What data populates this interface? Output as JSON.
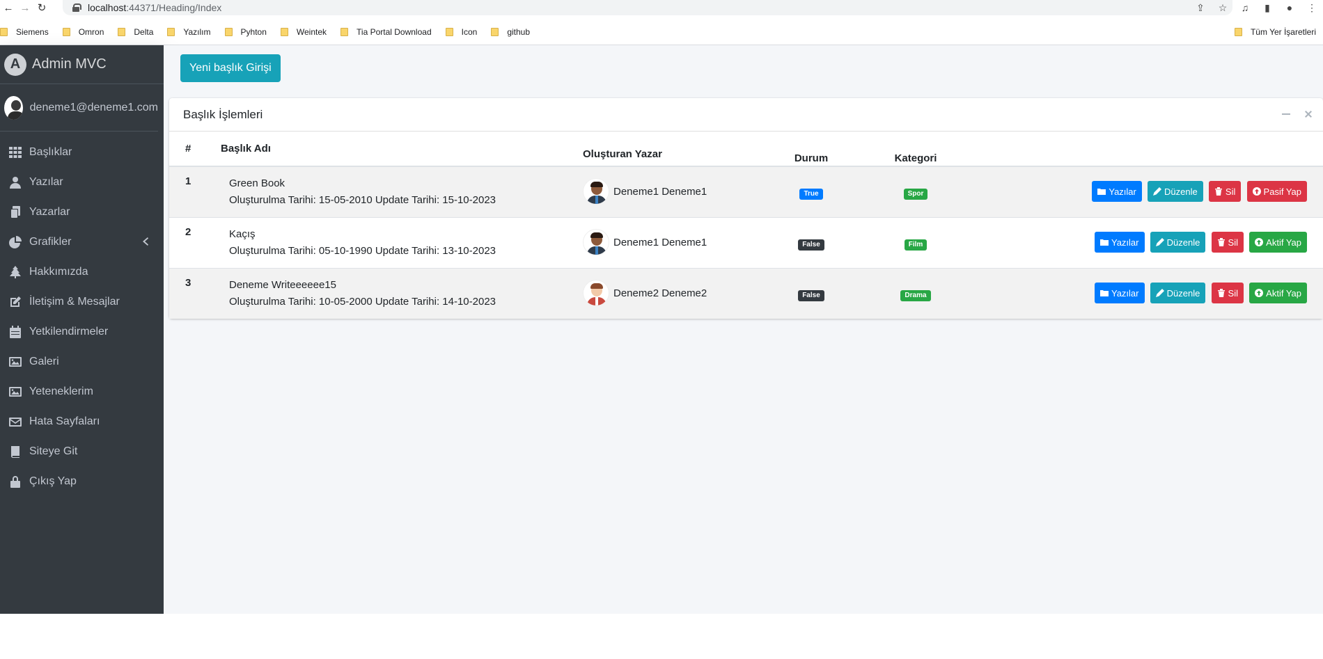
{
  "browser": {
    "url_host": "localhost",
    "url_path": ":44371/Heading/Index",
    "bookmarks": [
      "Siemens",
      "Omron",
      "Delta",
      "Yazılım",
      "Pyhton",
      "Weintek",
      "Tia Portal Download",
      "Icon",
      "github"
    ],
    "bookmarks_right": "Tüm Yer İşaretleri"
  },
  "sidebar": {
    "brand": "Admin MVC",
    "user": "deneme1@deneme1.com",
    "items": [
      {
        "label": "Başlıklar",
        "icon": "grid-icon"
      },
      {
        "label": "Yazılar",
        "icon": "user-tie-icon"
      },
      {
        "label": "Yazarlar",
        "icon": "copy-icon"
      },
      {
        "label": "Grafikler",
        "icon": "chart-pie-icon"
      },
      {
        "label": "Hakkımızda",
        "icon": "tree-icon"
      },
      {
        "label": "İletişim & Mesajlar",
        "icon": "edit-icon"
      },
      {
        "label": "Yetkilendirmeler",
        "icon": "calendar-icon"
      },
      {
        "label": "Galeri",
        "icon": "image-icon"
      },
      {
        "label": "Yeteneklerim",
        "icon": "image-icon"
      },
      {
        "label": "Hata Sayfaları",
        "icon": "envelope-icon"
      },
      {
        "label": "Siteye Git",
        "icon": "book-icon"
      },
      {
        "label": "Çıkış Yap",
        "icon": "lock-icon"
      }
    ]
  },
  "content": {
    "new_button": "Yeni başlık Girişi",
    "card_title": "Başlık İşlemleri",
    "columns": [
      "#",
      "Başlık Adı",
      "Oluşturan Yazar",
      "Durum",
      "Kategori"
    ],
    "rows": [
      {
        "idx": "1",
        "title": "Green Book",
        "dates": "Oluşturulma Tarihi: 15-05-2010 Update Tarihi: 15-10-2023",
        "author": "Deneme1 Deneme1",
        "status": "True",
        "category": "Spor",
        "toggle": "Pasif Yap"
      },
      {
        "idx": "2",
        "title": "Kaçış",
        "dates": "Oluşturulma Tarihi: 05-10-1990 Update Tarihi: 13-10-2023",
        "author": "Deneme1 Deneme1",
        "status": "False",
        "category": "Film",
        "toggle": "Aktif Yap"
      },
      {
        "idx": "3",
        "title": "Deneme Writeeeeee15",
        "dates": "Oluşturulma Tarihi: 10-05-2000 Update Tarihi: 14-10-2023",
        "author": "Deneme2 Deneme2",
        "status": "False",
        "category": "Drama",
        "toggle": "Aktif Yap"
      }
    ],
    "actions": {
      "yazilar": "Yazılar",
      "duzenle": "Düzenle",
      "sil": "Sil"
    }
  },
  "colors": {
    "sidebar_bg": "#343a40",
    "info": "#17a2b8",
    "primary": "#007bff",
    "danger": "#dc3545",
    "success": "#28a745"
  }
}
